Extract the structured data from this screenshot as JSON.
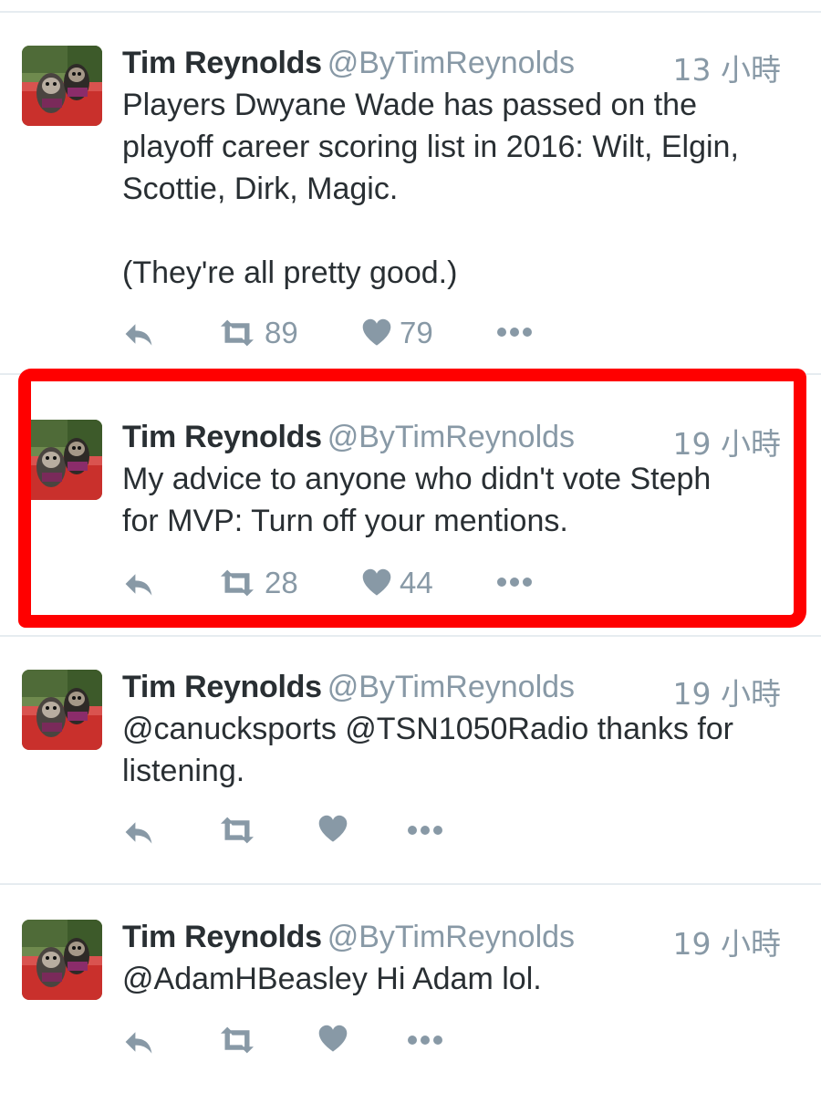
{
  "colors": {
    "name": "#292f33",
    "muted": "#8899a6",
    "highlight": "#ff0000",
    "divider": "#e6ecf0"
  },
  "tweets": [
    {
      "name": "Tim Reynolds",
      "handle": "@ByTimReynolds",
      "time": "13 小時",
      "text": "Players Dwyane Wade has passed on the\nplayoff career scoring list in 2016: Wilt, Elgin,\nScottie, Dirk, Magic.\n\n(They're all pretty good.)",
      "retweets": "89",
      "likes": "79"
    },
    {
      "name": "Tim Reynolds",
      "handle": "@ByTimReynolds",
      "time": "19 小時",
      "text": "My advice to anyone who didn't vote Steph\nfor MVP: Turn off your mentions.",
      "retweets": "28",
      "likes": "44"
    },
    {
      "name": "Tim Reynolds",
      "handle": "@ByTimReynolds",
      "time": "19 小時",
      "text": "@canucksports @TSN1050Radio thanks for\nlistening.",
      "retweets": "",
      "likes": ""
    },
    {
      "name": "Tim Reynolds",
      "handle": "@ByTimReynolds",
      "time": "19 小時",
      "text": "@AdamHBeasley Hi Adam lol.",
      "retweets": "",
      "likes": ""
    }
  ],
  "icons": [
    "reply-icon",
    "retweet-icon",
    "like-icon",
    "more-icon"
  ]
}
